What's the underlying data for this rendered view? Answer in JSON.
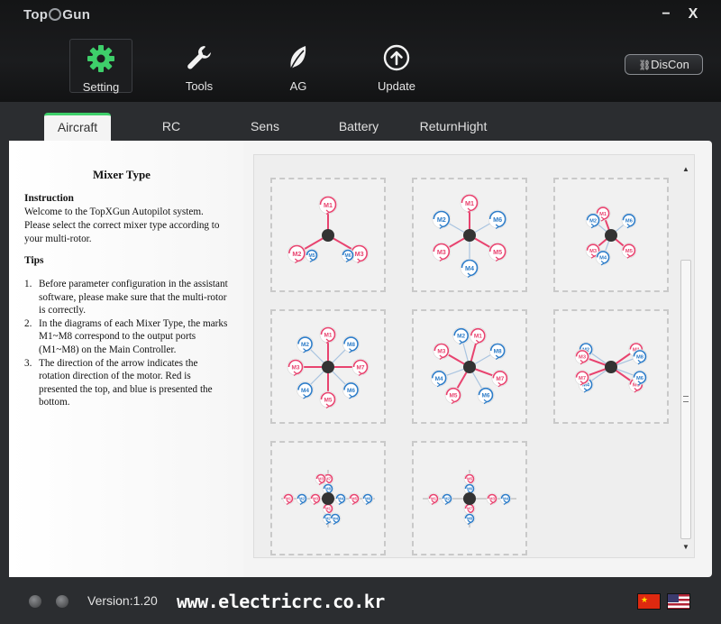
{
  "app": {
    "logo": "TopXGun"
  },
  "window": {
    "minimize": "−",
    "close": "X"
  },
  "toolbar": [
    {
      "label": "Setting",
      "icon": "gear-icon",
      "active": true
    },
    {
      "label": "Tools",
      "icon": "wrench-icon"
    },
    {
      "label": "AG",
      "icon": "leaf-icon"
    },
    {
      "label": "Update",
      "icon": "upload-icon"
    }
  ],
  "connect_button": "DisCon",
  "tabs": [
    "Aircraft",
    "RC",
    "Sens",
    "Battery",
    "ReturnHight"
  ],
  "left": {
    "title": "Mixer Type",
    "instruction_heading": "Instruction",
    "instruction_text": "Welcome to the TopXGun Autopilot system. Please select the correct mixer type according to your multi-rotor.",
    "tips_heading": "Tips",
    "tips": [
      {
        "n": "1.",
        "text": "Before parameter configuration in the assistant software, please make sure that the multi-rotor is correctly."
      },
      {
        "n": "2.",
        "text": "In the diagrams of each Mixer Type, the marks M1~M8 correspond to the output ports (M1~M8) on the Main Controller."
      },
      {
        "n": "3.",
        "text": "The direction of the arrow indicates the rotation direction of the motor. Red is presented the top, and blue is presented the bottom."
      }
    ]
  },
  "mixers": [
    {
      "motors": [
        [
          "M1",
          "r"
        ],
        [
          "M2",
          "r"
        ],
        [
          "M3",
          "r"
        ]
      ],
      "inner": [
        [
          "M5",
          "b"
        ],
        [
          "M6",
          "b"
        ]
      ]
    },
    {
      "motors": [
        [
          "M1",
          "r"
        ],
        [
          "M2",
          "b"
        ],
        [
          "M3",
          "r"
        ],
        [
          "M4",
          "b"
        ],
        [
          "M5",
          "r"
        ],
        [
          "M6",
          "b"
        ]
      ]
    },
    {
      "motors": [
        [
          "M1",
          "r"
        ],
        [
          "M2",
          "b"
        ],
        [
          "M3",
          "r"
        ],
        [
          "M4",
          "b"
        ],
        [
          "M5",
          "r"
        ],
        [
          "M6",
          "b"
        ]
      ]
    },
    {
      "motors": [
        [
          "M1",
          "r"
        ],
        [
          "M2",
          "b"
        ],
        [
          "M3",
          "r"
        ],
        [
          "M4",
          "b"
        ],
        [
          "M5",
          "r"
        ],
        [
          "M6",
          "b"
        ],
        [
          "M7",
          "r"
        ],
        [
          "M8",
          "b"
        ]
      ]
    },
    {
      "motors": [
        [
          "M1",
          "r"
        ],
        [
          "M2",
          "b"
        ],
        [
          "M3",
          "r"
        ],
        [
          "M4",
          "b"
        ],
        [
          "M5",
          "r"
        ],
        [
          "M6",
          "b"
        ],
        [
          "M7",
          "r"
        ],
        [
          "M8",
          "b"
        ]
      ]
    },
    {
      "motors": [
        [
          "M1",
          "r"
        ],
        [
          "M2",
          "b"
        ],
        [
          "M3",
          "r"
        ],
        [
          "M4",
          "b"
        ],
        [
          "M5",
          "r"
        ],
        [
          "M6",
          "b"
        ],
        [
          "M7",
          "r"
        ],
        [
          "M8",
          "b"
        ]
      ]
    },
    {
      "motors": [
        [
          "M1",
          "r"
        ],
        [
          "M2",
          "b"
        ],
        [
          "M3",
          "r"
        ],
        [
          "M4",
          "b"
        ],
        [
          "M5",
          "r"
        ],
        [
          "M6",
          "b"
        ],
        [
          "M7",
          "r"
        ],
        [
          "M8",
          "b"
        ]
      ]
    },
    {
      "motors": [
        [
          "M1",
          "r"
        ],
        [
          "M2",
          "b"
        ],
        [
          "M3",
          "r"
        ],
        [
          "M4",
          "b"
        ],
        [
          "M5",
          "r"
        ],
        [
          "M6",
          "b"
        ],
        [
          "M7",
          "r"
        ],
        [
          "M8",
          "b"
        ]
      ]
    }
  ],
  "status": {
    "version": "Version:1.20",
    "watermark": "www.electricrc.co.kr"
  },
  "colors": {
    "accent": "#3ecf6a",
    "motor_red": "#e8436f",
    "motor_blue": "#2d7cc8",
    "hub": "#333333"
  }
}
